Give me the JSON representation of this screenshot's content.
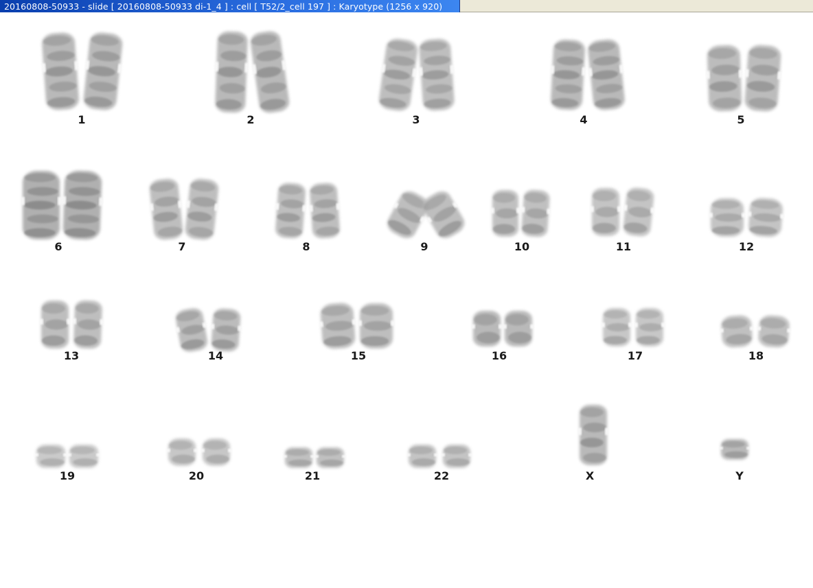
{
  "window": {
    "title": "20160808-50933 - slide [ 20160808-50933 di-1_4 ] : cell [ T52/2_cell 197 ] : Karyotype  (1256 x 920)"
  },
  "karyotype": {
    "chromosomes": [
      {
        "label": "1"
      },
      {
        "label": "2"
      },
      {
        "label": "3"
      },
      {
        "label": "4"
      },
      {
        "label": "5"
      },
      {
        "label": "6"
      },
      {
        "label": "7"
      },
      {
        "label": "8"
      },
      {
        "label": "9"
      },
      {
        "label": "10"
      },
      {
        "label": "11"
      },
      {
        "label": "12"
      },
      {
        "label": "13"
      },
      {
        "label": "14"
      },
      {
        "label": "15"
      },
      {
        "label": "16"
      },
      {
        "label": "17"
      },
      {
        "label": "18"
      },
      {
        "label": "19"
      },
      {
        "label": "20"
      },
      {
        "label": "21"
      },
      {
        "label": "22"
      },
      {
        "label": "X"
      },
      {
        "label": "Y"
      }
    ]
  },
  "colors": {
    "titlebar_active": "#2a6de0",
    "titlebar_text": "#ffffff",
    "background": "#ffffff",
    "chromosome_gray": "#8a8a8a"
  }
}
